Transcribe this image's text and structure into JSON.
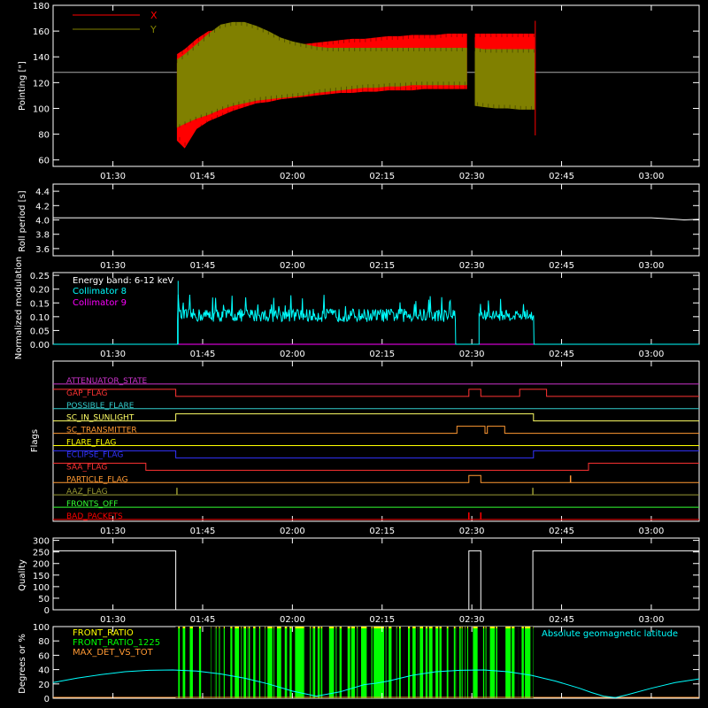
{
  "time_ticks": [
    "01:30",
    "01:45",
    "02:00",
    "02:15",
    "02:30",
    "02:45",
    "03:00"
  ],
  "tick_minutes": [
    90,
    105,
    120,
    135,
    150,
    165,
    180
  ],
  "x_range_minutes": [
    80,
    188
  ],
  "chart_data": [
    {
      "id": "pointing",
      "type": "area",
      "ylabel": "Pointing [\"]",
      "ylim": [
        55,
        180
      ],
      "yticks": [
        60,
        80,
        100,
        120,
        140,
        160,
        180
      ],
      "reference_line": 128,
      "legend": [
        {
          "name": "X",
          "color": "#ff0000"
        },
        {
          "name": "Y",
          "color": "#808000"
        }
      ],
      "series": [
        {
          "name": "X",
          "color": "#ff0000",
          "x": [
            100.7,
            102,
            104,
            106,
            108,
            110,
            112,
            114,
            116,
            118,
            120,
            122,
            124,
            126,
            128,
            130,
            132,
            134,
            136,
            138,
            140,
            142,
            144,
            146,
            148,
            149.2,
            null,
            150.5,
            152,
            154,
            156,
            158,
            160.5
          ],
          "upper": [
            142,
            146,
            154,
            160,
            161,
            162,
            162,
            161,
            158,
            154,
            150,
            150,
            151,
            152,
            153,
            154,
            154,
            155,
            156,
            156,
            157,
            157,
            157,
            158,
            158,
            158,
            null,
            158,
            158,
            158,
            158,
            158,
            158
          ],
          "lower": [
            75,
            69,
            84,
            90,
            94,
            98,
            101,
            104,
            105,
            107,
            108,
            109,
            110,
            111,
            112,
            112,
            113,
            113,
            114,
            114,
            114,
            115,
            115,
            115,
            115,
            115,
            null,
            132,
            132,
            132,
            131,
            131,
            131
          ]
        },
        {
          "name": "Y",
          "color": "#808000",
          "x": [
            100.7,
            102,
            104,
            106,
            108,
            110,
            112,
            114,
            116,
            118,
            120,
            122,
            124,
            126,
            128,
            130,
            132,
            134,
            136,
            138,
            140,
            142,
            144,
            146,
            148,
            149.2,
            null,
            150.5,
            152,
            154,
            156,
            158,
            160.5
          ],
          "upper": [
            138,
            142,
            150,
            158,
            165,
            167,
            167,
            164,
            160,
            155,
            152,
            150,
            148,
            147,
            147,
            147,
            147,
            147,
            147,
            147,
            147,
            147,
            147,
            147,
            147,
            147,
            null,
            147,
            146,
            146,
            146,
            146,
            146
          ],
          "lower": [
            85,
            88,
            92,
            95,
            99,
            102,
            104,
            106,
            107,
            108,
            109,
            110,
            112,
            113,
            114,
            115,
            116,
            116,
            117,
            117,
            118,
            118,
            118,
            118,
            118,
            118,
            null,
            102,
            101,
            100,
            100,
            99,
            99
          ]
        }
      ]
    },
    {
      "id": "roll_period",
      "type": "line",
      "ylabel": "Roll period [s]",
      "ylim": [
        3.5,
        4.5
      ],
      "yticks": [
        3.6,
        3.8,
        4.0,
        4.2,
        4.4
      ],
      "yticklabels": [
        "3.6",
        "3.8",
        "4.0",
        "4.2",
        "4.4"
      ],
      "series": [
        {
          "name": "",
          "color": "#ffffff",
          "x": [
            80,
            100,
            120,
            140,
            160,
            180,
            182,
            184,
            185.5,
            188
          ],
          "y": [
            4.03,
            4.03,
            4.03,
            4.03,
            4.03,
            4.03,
            4.02,
            4.01,
            4.0,
            4.01
          ]
        }
      ]
    },
    {
      "id": "modulation",
      "type": "line",
      "ylabel": "Normalized modulation",
      "ylim": [
        0,
        0.26
      ],
      "yticks": [
        0.0,
        0.05,
        0.1,
        0.15,
        0.2,
        0.25
      ],
      "yticklabels": [
        "0.00",
        "0.05",
        "0.10",
        "0.15",
        "0.20",
        "0.25"
      ],
      "annotation": "Energy band: 6-12 keV",
      "legend": [
        {
          "name": "Collimator 8",
          "color": "#00ffff"
        },
        {
          "name": "Collimator 9",
          "color": "#ff00ff"
        }
      ],
      "series": [
        {
          "name": "Collimator 8",
          "color": "#00ffff",
          "segments": [
            {
              "x0": 100.8,
              "x1": 147.3,
              "mean": 0.105,
              "noise": 0.03
            },
            {
              "x0": 151.2,
              "x1": 160.4,
              "mean": 0.105,
              "noise": 0.025
            }
          ],
          "spike": {
            "x": 100.9,
            "y": 0.23
          }
        },
        {
          "name": "Collimator 9",
          "color": "#ff00ff",
          "baseline": 0.0
        }
      ]
    },
    {
      "id": "flags",
      "type": "line",
      "ylabel": "Flags",
      "flags": [
        {
          "name": "ATTENUATOR_STATE",
          "color": "#cc33cc",
          "steps": [
            [
              80,
              0
            ]
          ]
        },
        {
          "name": "GAP_FLAG",
          "color": "#ff3333",
          "steps": [
            [
              80,
              1
            ],
            [
              100.5,
              0
            ],
            [
              149.5,
              1
            ],
            [
              151.5,
              0
            ],
            [
              158,
              1
            ],
            [
              162.5,
              0
            ],
            [
              188,
              0
            ]
          ]
        },
        {
          "name": "POSSIBLE_FLARE",
          "color": "#33cccc",
          "steps": [
            [
              80,
              0
            ]
          ]
        },
        {
          "name": "SC_IN_SUNLIGHT",
          "color": "#ffff66",
          "steps": [
            [
              80,
              0
            ],
            [
              100.5,
              1
            ],
            [
              160.3,
              0
            ]
          ]
        },
        {
          "name": "SC_TRANSMITTER",
          "color": "#ff9933",
          "steps": [
            [
              80,
              0
            ],
            [
              147.5,
              1
            ],
            [
              152.2,
              0
            ],
            [
              152.6,
              1
            ],
            [
              155.5,
              0
            ]
          ]
        },
        {
          "name": "FLARE_FLAG",
          "color": "#ffff00",
          "steps": [
            [
              80,
              0
            ]
          ]
        },
        {
          "name": "ECLIPSE_FLAG",
          "color": "#3333ff",
          "steps": [
            [
              80,
              1
            ],
            [
              100.5,
              0
            ],
            [
              160.3,
              1
            ]
          ]
        },
        {
          "name": "SAA_FLAG",
          "color": "#ff3333",
          "steps": [
            [
              80,
              1
            ],
            [
              95.5,
              0
            ],
            [
              169.5,
              1
            ]
          ]
        },
        {
          "name": "PARTICLE_FLAG",
          "color": "#ff9933",
          "steps": [
            [
              80,
              0
            ],
            [
              149.5,
              1
            ],
            [
              151.5,
              0
            ]
          ],
          "spikes": [
            166.5
          ]
        },
        {
          "name": "AAZ_FLAG",
          "color": "#999933",
          "steps": [
            [
              80,
              0
            ]
          ],
          "spikes": [
            100.7,
            160.2
          ]
        },
        {
          "name": "FRONTS_OFF",
          "color": "#33ff33",
          "steps": [
            [
              80,
              0
            ]
          ]
        },
        {
          "name": "BAD_PACKETS",
          "color": "#ff0000",
          "steps": [
            [
              80,
              0
            ]
          ],
          "spikes": [
            149.5,
            151.5
          ]
        }
      ]
    },
    {
      "id": "quality",
      "type": "line",
      "ylabel": "Quality",
      "ylim": [
        0,
        310
      ],
      "yticks": [
        0,
        50,
        100,
        150,
        200,
        250,
        300
      ],
      "series": [
        {
          "name": "",
          "color": "#ffffff",
          "x": [
            80,
            100.5,
            100.5,
            149.5,
            149.5,
            151.5,
            151.5,
            160.2,
            160.2,
            188
          ],
          "y": [
            255,
            255,
            0,
            0,
            255,
            255,
            0,
            0,
            255,
            255
          ]
        }
      ]
    },
    {
      "id": "latitude",
      "type": "line",
      "ylabel": "Degrees or %",
      "ylim": [
        0,
        100
      ],
      "yticks": [
        0,
        20,
        40,
        60,
        80,
        100
      ],
      "legend": [
        {
          "name": "FRONT_RATIO",
          "color": "#ffff00"
        },
        {
          "name": "FRONT_RATIO_1225",
          "color": "#00ff00"
        },
        {
          "name": "MAX_DET_VS_TOT",
          "color": "#ff9933"
        }
      ],
      "annotation": "Absolute geomagnetic latitude",
      "annotation_color": "#00ffff",
      "front_ratio_span": [
        100.7,
        160.3
      ],
      "series": [
        {
          "name": "Absolute geomagnetic latitude",
          "color": "#00ffff",
          "x": [
            80,
            84,
            88,
            92,
            96,
            100,
            104,
            108,
            112,
            116,
            120,
            124,
            128,
            132,
            134,
            136,
            140,
            144,
            148,
            152,
            156,
            160,
            164,
            168,
            170,
            172,
            174,
            176,
            180,
            184,
            188
          ],
          "y": [
            22,
            28,
            33,
            37,
            39,
            39.5,
            38,
            34,
            28,
            20,
            10,
            3,
            9,
            19,
            21,
            24,
            32,
            37,
            39,
            39.5,
            37,
            32,
            24,
            14,
            8,
            3,
            1,
            5,
            14,
            22,
            27
          ]
        }
      ]
    }
  ]
}
